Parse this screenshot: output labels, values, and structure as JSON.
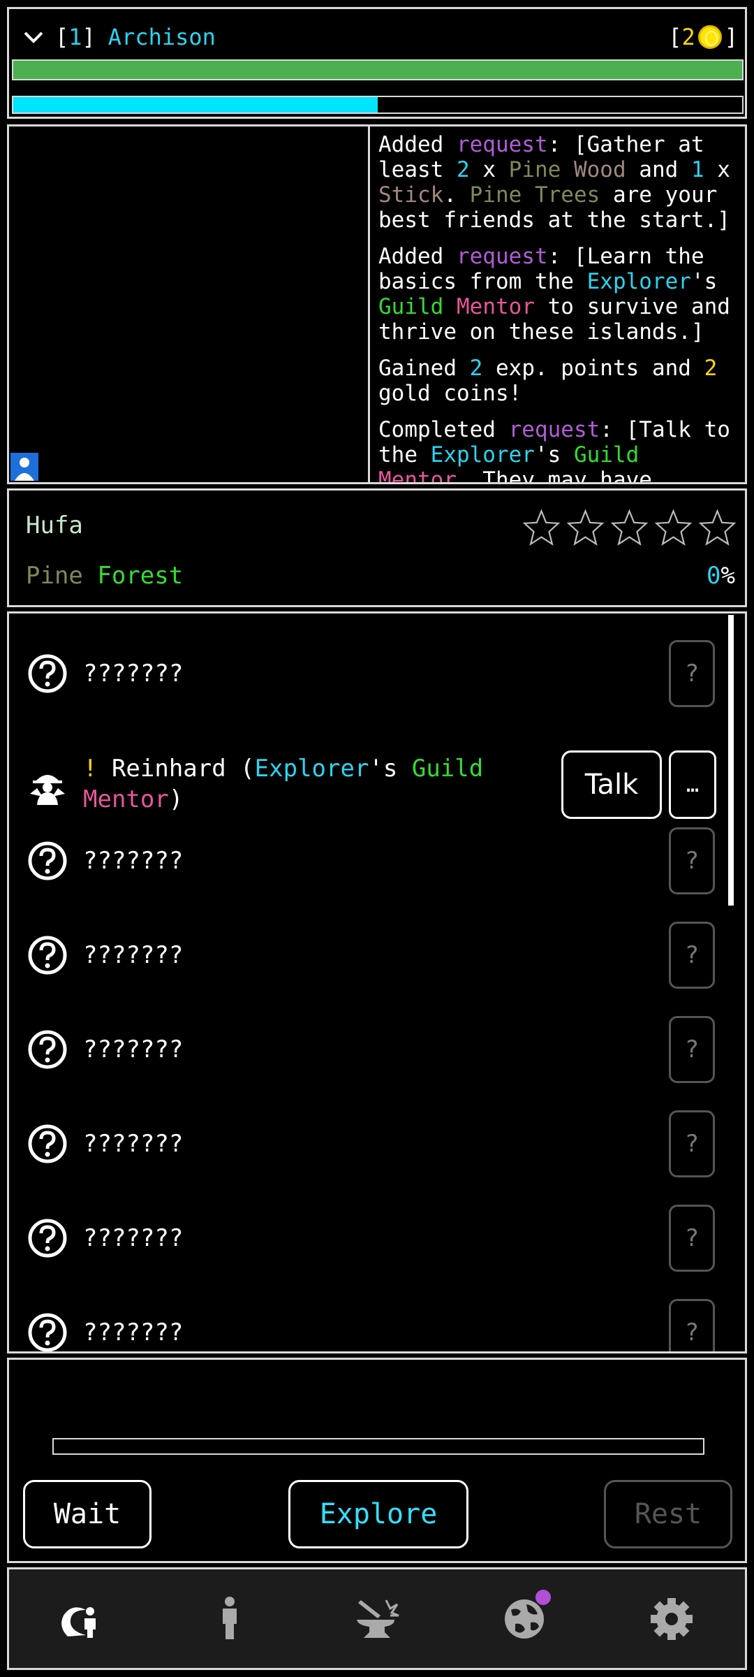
{
  "header": {
    "level_open": "[",
    "level": "1",
    "level_close": "]",
    "player_name": "Archison",
    "coins_open": "[",
    "coins": "2",
    "coins_close": "]",
    "hp_fraction": 1.0,
    "xp_fraction": 0.5
  },
  "log": [
    [
      {
        "t": "Added ",
        "c": "#ffffff"
      },
      {
        "t": "request",
        "c": "#b15cd6"
      },
      {
        "t": ": [Gather at least ",
        "c": "#ffffff"
      },
      {
        "t": "2",
        "c": "#2ad4f0"
      },
      {
        "t": " x ",
        "c": "#ffffff"
      },
      {
        "t": "Pine",
        "c": "#7d8a5a"
      },
      {
        "t": " ",
        "c": "#ffffff"
      },
      {
        "t": "Wood",
        "c": "#a1887f"
      },
      {
        "t": " and ",
        "c": "#ffffff"
      },
      {
        "t": "1",
        "c": "#2ad4f0"
      },
      {
        "t": " x ",
        "c": "#ffffff"
      },
      {
        "t": "Stick",
        "c": "#a1887f"
      },
      {
        "t": ". ",
        "c": "#ffffff"
      },
      {
        "t": "Pine",
        "c": "#7d8a5a"
      },
      {
        "t": " ",
        "c": "#ffffff"
      },
      {
        "t": "Trees",
        "c": "#7d8a5a"
      },
      {
        "t": " are your best friends at the start.]",
        "c": "#ffffff"
      }
    ],
    [
      {
        "t": "Added ",
        "c": "#ffffff"
      },
      {
        "t": "request",
        "c": "#b15cd6"
      },
      {
        "t": ": [Learn the basics from the ",
        "c": "#ffffff"
      },
      {
        "t": "Explorer",
        "c": "#2ad4f0"
      },
      {
        "t": "'s ",
        "c": "#ffffff"
      },
      {
        "t": "Guild",
        "c": "#33dd33"
      },
      {
        "t": " ",
        "c": "#ffffff"
      },
      {
        "t": "Mentor",
        "c": "#e8559a"
      },
      {
        "t": " to survive and thrive on these islands.]",
        "c": "#ffffff"
      }
    ],
    [
      {
        "t": "Gained ",
        "c": "#ffffff"
      },
      {
        "t": "2",
        "c": "#2ad4f0"
      },
      {
        "t": " exp. points and ",
        "c": "#ffffff"
      },
      {
        "t": "2",
        "c": "#ffd600"
      },
      {
        "t": " gold coins!",
        "c": "#ffffff"
      }
    ],
    [
      {
        "t": "Completed ",
        "c": "#ffffff"
      },
      {
        "t": "request",
        "c": "#b15cd6"
      },
      {
        "t": ": [Talk to the ",
        "c": "#ffffff"
      },
      {
        "t": "Explorer",
        "c": "#2ad4f0"
      },
      {
        "t": "'s ",
        "c": "#ffffff"
      },
      {
        "t": "Guild",
        "c": "#33dd33"
      },
      {
        "t": " ",
        "c": "#ffffff"
      },
      {
        "t": "Mentor",
        "c": "#e8559a"
      },
      {
        "t": ". They may have",
        "c": "#ffffff"
      }
    ]
  ],
  "location": {
    "name": "Hufa",
    "biome_part1": "Pine",
    "biome_part2": "Forest",
    "progress_value": "0",
    "progress_unit": "%",
    "stars_filled": 0,
    "stars_total": 5
  },
  "encounters": [
    {
      "label": "???????",
      "button": "?",
      "known": false
    },
    {
      "known": true,
      "prefix": "!",
      "name": " Reinhard (",
      "role1": "Explorer",
      "role_mid": "'s ",
      "role2": "Guild",
      "role3": "Mentor",
      "suffix": ")",
      "talk": "Talk",
      "more": "…"
    },
    {
      "label": "???????",
      "button": "?",
      "known": false
    },
    {
      "label": "???????",
      "button": "?",
      "known": false
    },
    {
      "label": "???????",
      "button": "?",
      "known": false
    },
    {
      "label": "???????",
      "button": "?",
      "known": false
    },
    {
      "label": "???????",
      "button": "?",
      "known": false
    },
    {
      "label": "???????",
      "button": "?",
      "known": false
    }
  ],
  "actions": {
    "wait": "Wait",
    "explore": "Explore",
    "rest": "Rest",
    "progress_fraction": 0
  },
  "nav": [
    {
      "icon": "adventure-icon",
      "active": true
    },
    {
      "icon": "character-icon",
      "active": false
    },
    {
      "icon": "crafting-icon",
      "active": false
    },
    {
      "icon": "world-map-icon",
      "active": false,
      "notification": true
    },
    {
      "icon": "settings-gear-icon",
      "active": false
    }
  ],
  "colors": {
    "cyan": "#2ad4f0",
    "green": "#33dd33",
    "purple": "#b15cd6",
    "pink": "#e8559a",
    "gold": "#ffd600"
  }
}
